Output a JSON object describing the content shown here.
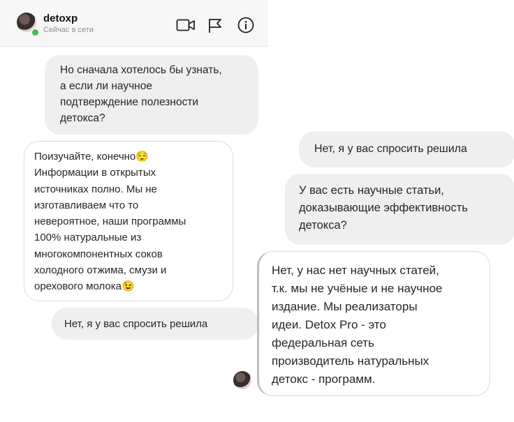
{
  "header": {
    "username": "detoxp",
    "status": "Сейчас в сети",
    "icons": [
      "video-camera-icon",
      "flag-icon",
      "info-icon"
    ]
  },
  "messages": [
    {
      "id": "m1",
      "text": "Но сначала хотелось бы узнать,\nа если ли научное\nподтверждение полезности\nдетокса?",
      "side": "sent"
    },
    {
      "id": "m2",
      "text": "Поизучайте, конечно😌\nИнформации в открытых\nисточниках полно. Мы не\nизготавливаем что то\nневероятное, наши программы\n100% натуральные из\nмногокомпонентных соков\nхолодного отжима, смузи и\nорехового молока😉",
      "side": "received"
    },
    {
      "id": "m3",
      "text": "Нет, я у вас спросить решила",
      "side": "sent"
    },
    {
      "id": "m4",
      "text": "Нет, я у вас спросить решила",
      "side": "sent"
    },
    {
      "id": "m5",
      "text": "У вас есть научные статьи,\nдоказывающие эффективность\nдетокса?",
      "side": "sent"
    },
    {
      "id": "m6",
      "text": "Нет, у нас нет научных статей,\nт.к. мы не учёные и не научное\nиздание. Мы реализаторы\nидеи. Detox Pro - это\nфедеральная сеть\nпроизводитель натуральных\nдетокс - программ.",
      "side": "received"
    }
  ],
  "colors": {
    "sent_bubble": "#efefef",
    "received_border": "#dbdbdb",
    "online": "#40c057"
  }
}
